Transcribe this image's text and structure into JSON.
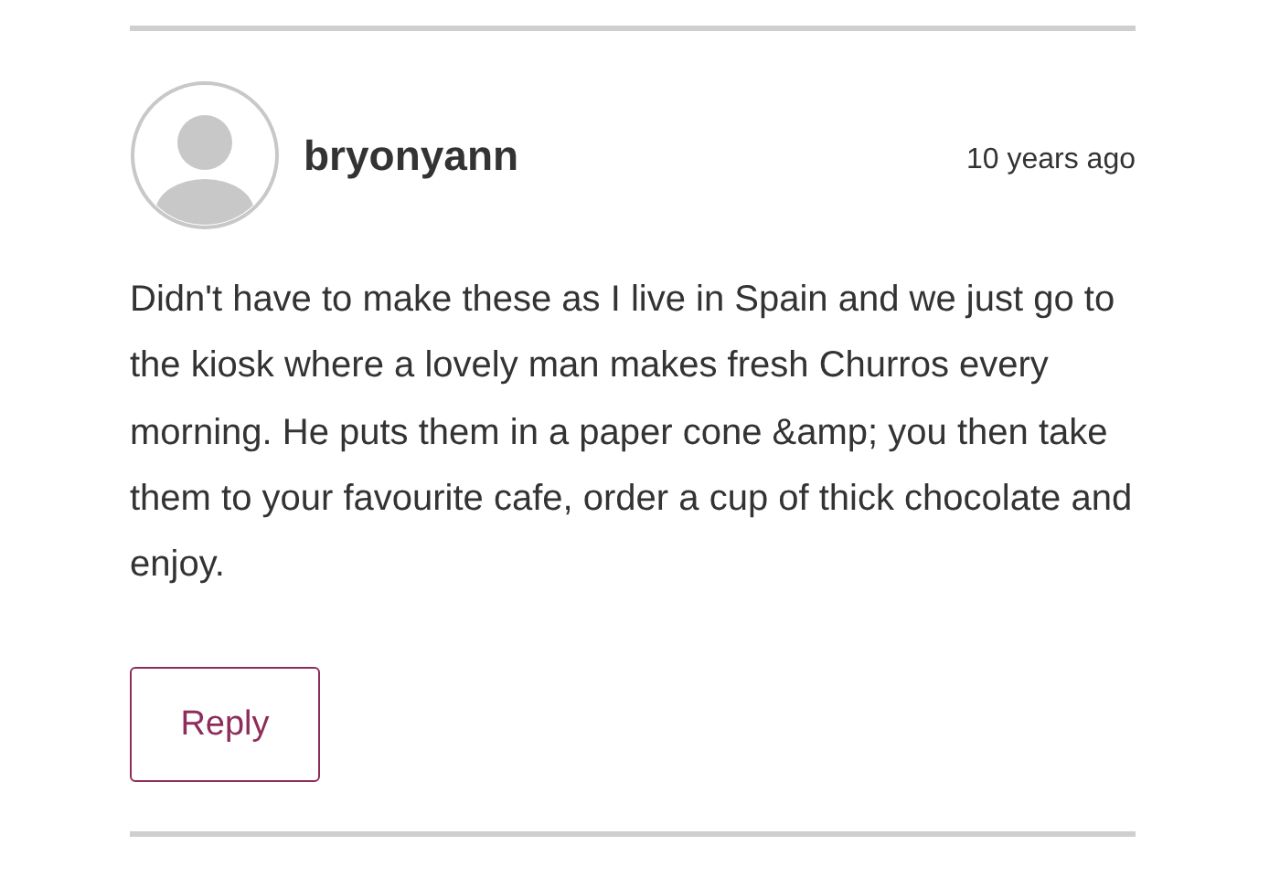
{
  "comment": {
    "author": "bryonyann",
    "time": "10 years ago",
    "text": "Didn't have to make these as I live in Spain and we just go to the kiosk where a lovely man makes fresh Churros every morning. He puts them in a paper cone &amp; you then take them to your favourite cafe, order a cup of thick chocolate and enjoy.",
    "reply_button": "Reply"
  }
}
